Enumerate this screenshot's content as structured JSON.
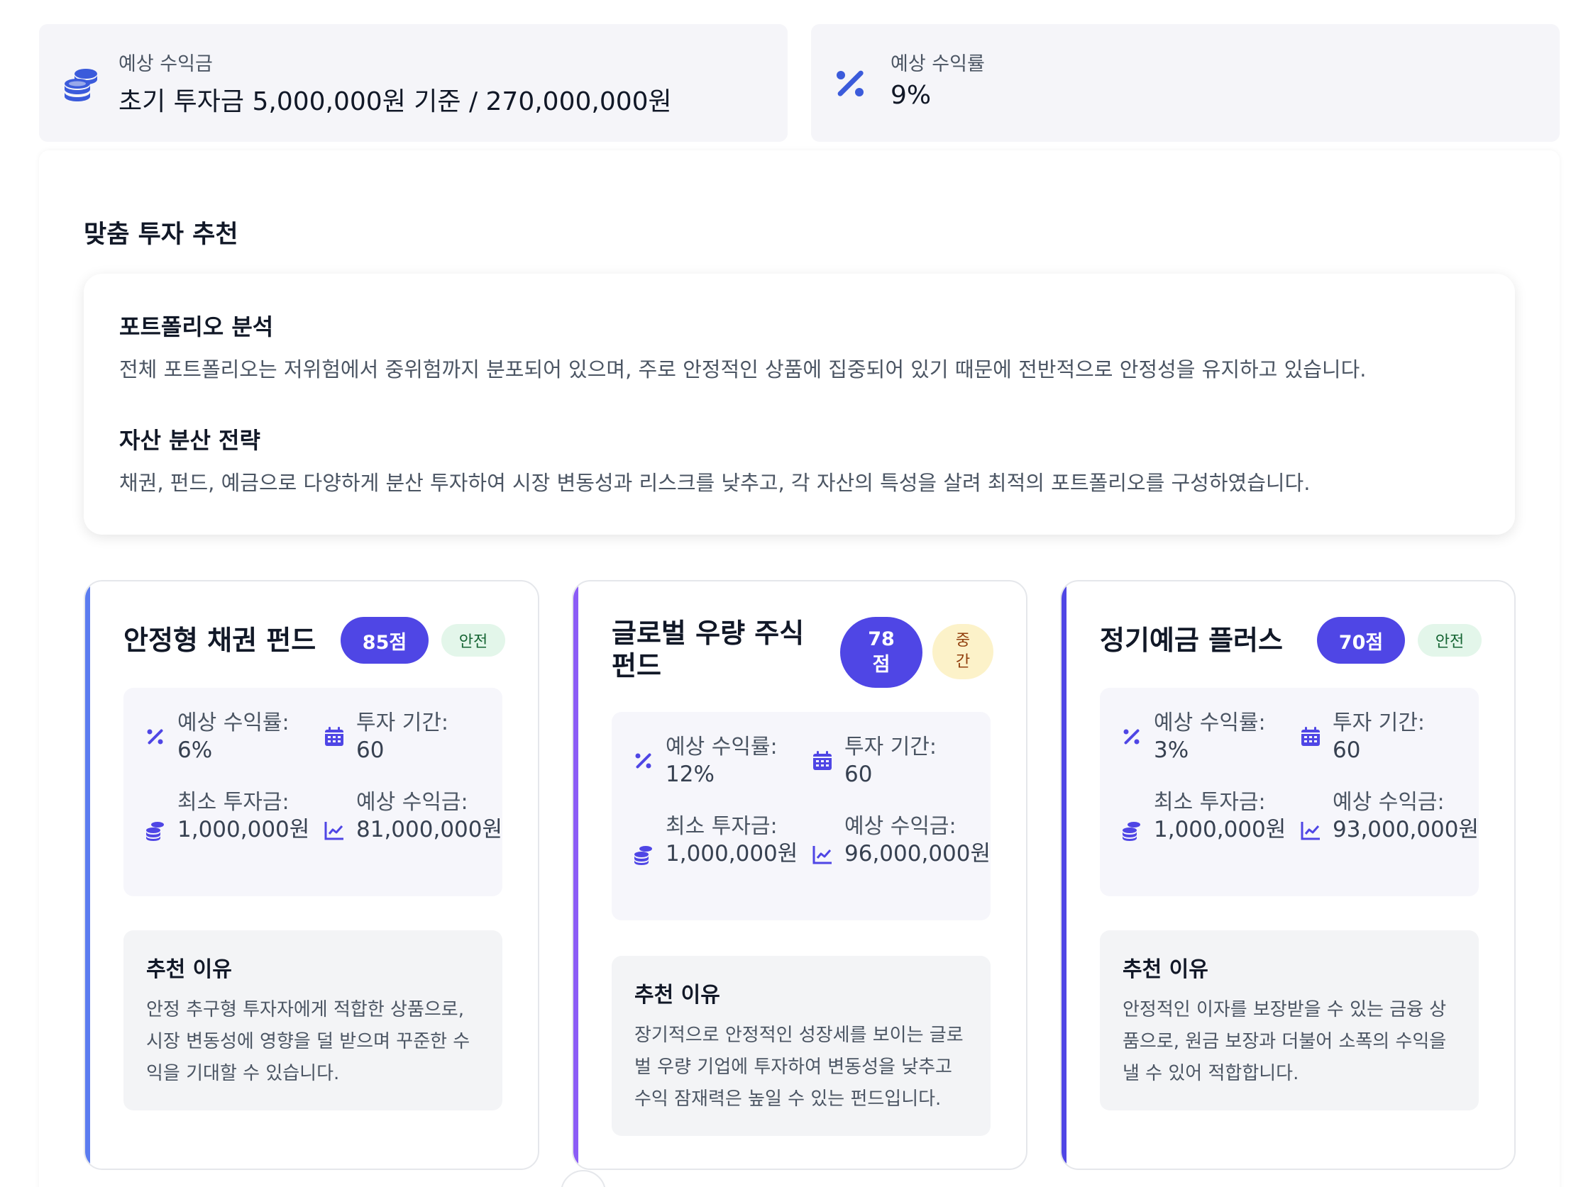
{
  "summary": {
    "expected_profit": {
      "label": "예상 수익금",
      "value": "초기 투자금 5,000,000원 기준 / 270,000,000원",
      "icon": "coins-icon"
    },
    "expected_rate": {
      "label": "예상 수익률",
      "value": "9%",
      "icon": "percent-icon"
    }
  },
  "section_title": "맞춤 투자 추천",
  "analysis": {
    "portfolio_title": "포트폴리오 분석",
    "portfolio_text": "전체 포트폴리오는 저위험에서 중위험까지 분포되어 있으며, 주로 안정적인 상품에 집중되어 있기 때문에 전반적으로 안정성을 유지하고 있습니다.",
    "strategy_title": "자산 분산 전략",
    "strategy_text": "채권, 펀드, 예금으로 다양하게 분산 투자하여 시장 변동성과 리스크를 낮추고, 각 자산의 특성을 살려 최적의 포트폴리오를 구성하였습니다."
  },
  "labels": {
    "rate": "예상 수익률:",
    "period": "투자 기간:",
    "min": "최소 투자금:",
    "profit": "예상 수익금:",
    "reason": "추천 이유"
  },
  "products": [
    {
      "title": "안정형 채권 펀드",
      "score": "85점",
      "risk": "안전",
      "rate": "6%",
      "period": "60",
      "min": "1,000,000원",
      "profit": "81,000,000원",
      "reason": "안정 추구형 투자자에게 적합한 상품으로, 시장 변동성에 영향을 덜 받으며 꾸준한 수익을 기대할 수 있습니다."
    },
    {
      "title": "글로벌 우량 주식 펀드",
      "score": "78점",
      "risk": "중간",
      "rate": "12%",
      "period": "60",
      "min": "1,000,000원",
      "profit": "96,000,000원",
      "reason": "장기적으로 안정적인 성장세를 보이는 글로벌 우량 기업에 투자하여 변동성을 낮추고 수익 잠재력은 높일 수 있는 펀드입니다."
    },
    {
      "title": "정기예금 플러스",
      "score": "70점",
      "risk": "안전",
      "rate": "3%",
      "period": "60",
      "min": "1,000,000원",
      "profit": "93,000,000원",
      "reason": "안정적인 이자를 보장받을 수 있는 금융 상품으로, 원금 보장과 더불어 소폭의 수익을 낼 수 있어 적합합니다."
    }
  ],
  "colors": {
    "accent_blue": "#3b5bdb",
    "accent_purple": "#4f46e5",
    "card_accents": [
      "#5b7cf0",
      "#8b5cf6",
      "#4f46e5"
    ]
  }
}
